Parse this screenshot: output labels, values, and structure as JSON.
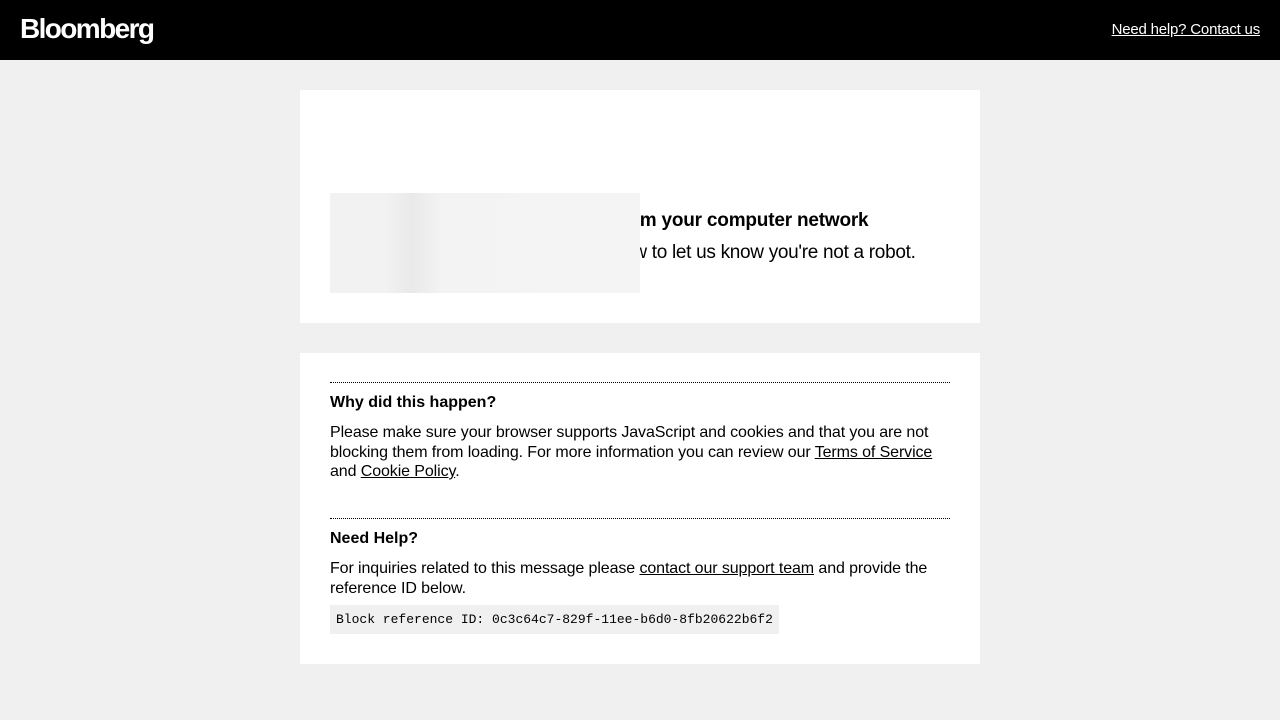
{
  "header": {
    "logo": "Bloomberg",
    "help_link": "Need help? Contact us"
  },
  "alert": {
    "title": "We've detected unusual activity from your computer network",
    "subtitle": "To continue, please click the box below to let us know you're not a robot."
  },
  "why": {
    "title": "Why did this happen?",
    "text_before": "Please make sure your browser supports JavaScript and cookies and that you are not blocking them from loading. For more information you can review our ",
    "terms_link": "Terms of Service",
    "text_middle": " and ",
    "cookie_link": "Cookie Policy",
    "text_after": "."
  },
  "help": {
    "title": "Need Help?",
    "text_before": "For inquiries related to this message please ",
    "support_link": "contact our support team",
    "text_after": " and provide the reference ID below."
  },
  "reference": {
    "label": "Block reference ID:",
    "id": "0c3c64c7-829f-11ee-b6d0-8fb20622b6f2"
  },
  "colors": {
    "header_bg": "#000000",
    "page_bg": "#f0f0f0",
    "card_bg": "#ffffff"
  }
}
